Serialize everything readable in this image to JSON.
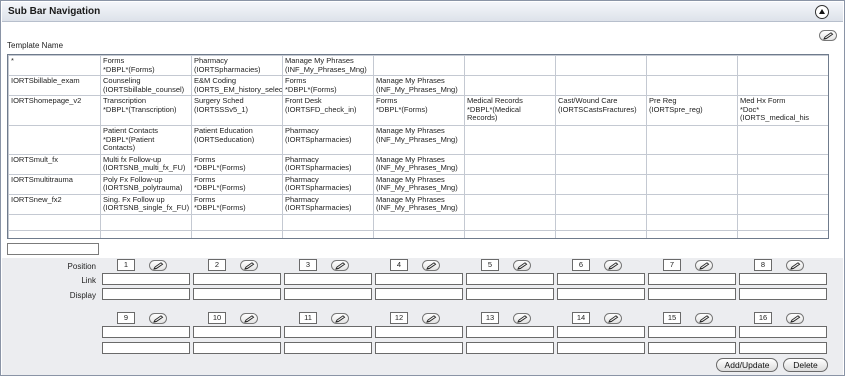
{
  "header": {
    "title": "Sub Bar Navigation"
  },
  "template": {
    "label": "Template Name"
  },
  "grid": {
    "rows": [
      [
        "*",
        "Forms\n*DBPL*(Forms)",
        "Pharmacy\n(IORTSpharmacies)",
        "Manage My Phrases\n(INF_My_Phrases_Mng)",
        "",
        "",
        "",
        "",
        ""
      ],
      [
        "IORTSbillable_exam",
        "Counseling\n(IORTSbillable_counsel)",
        "E&M Coding\n(IORTS_EM_history_selec",
        "Forms\n*DBPL*(Forms)",
        "Manage My Phrases\n(INF_My_Phrases_Mng)",
        "",
        "",
        "",
        ""
      ],
      [
        "IORTShomepage_v2",
        "Transcription\n*DBPL*(Transcription)",
        "Surgery Sched\n(IORTSSSv5_1)",
        "Front Desk\n(IORTSFD_check_in)",
        "Forms\n*DBPL*(Forms)",
        "Medical Records\n*DBPL*(Medical\nRecords)",
        "Cast/Wound Care\n(IORTSCastsFractures)",
        "Pre Reg\n(IORTSpre_reg)",
        "Med Hx Form\n*Doc*(IORTS_medical_his"
      ],
      [
        "",
        "Patient Contacts\n*DBPL*(Patient\nContacts)",
        "Patient Education\n(IORTSeducation)",
        "Pharmacy\n(IORTSpharmacies)",
        "Manage My Phrases\n(INF_My_Phrases_Mng)",
        "",
        "",
        "",
        ""
      ],
      [
        "IORTSmult_fx",
        "Multi fx Follow-up\n(IORTSNB_multi_fx_FU)",
        "Forms\n*DBPL*(Forms)",
        "Pharmacy\n(IORTSpharmacies)",
        "Manage My Phrases\n(INF_My_Phrases_Mng)",
        "",
        "",
        "",
        ""
      ],
      [
        "IORTSmultitrauma",
        "Poly Fx Follow-up\n(IORTSNB_polytrauma)",
        "Forms\n*DBPL*(Forms)",
        "Pharmacy\n(IORTSpharmacies)",
        "Manage My Phrases\n(INF_My_Phrases_Mng)",
        "",
        "",
        "",
        ""
      ],
      [
        "IORTSnew_fx2",
        "Sing. Fx Follow up\n(IORTSNB_single_fx_FU)",
        "Forms\n*DBPL*(Forms)",
        "Pharmacy\n(IORTSpharmacies)",
        "Manage My Phrases\n(INF_My_Phrases_Mng)",
        "",
        "",
        "",
        ""
      ]
    ]
  },
  "editor": {
    "labels": {
      "position": "Position",
      "link": "Link",
      "display": "Display"
    },
    "positions_row1": [
      "1",
      "2",
      "3",
      "4",
      "5",
      "6",
      "7",
      "8"
    ],
    "positions_row2": [
      "9",
      "10",
      "11",
      "12",
      "13",
      "14",
      "15",
      "16"
    ]
  },
  "buttons": {
    "add_update": "Add/Update",
    "delete": "Delete"
  },
  "icons": {
    "edit": "pencil-edit-icon",
    "collapse": "collapse-up-icon"
  }
}
